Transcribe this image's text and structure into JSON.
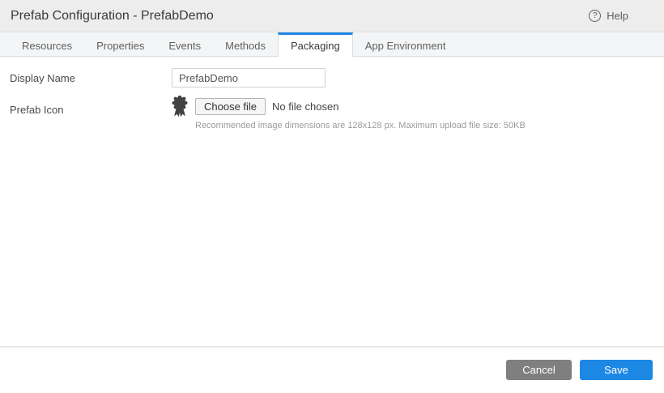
{
  "header": {
    "title": "Prefab Configuration - PrefabDemo",
    "help_label": "Help",
    "help_icon_glyph": "?"
  },
  "tabs": {
    "items": [
      {
        "label": "Resources",
        "active": false
      },
      {
        "label": "Properties",
        "active": false
      },
      {
        "label": "Events",
        "active": false
      },
      {
        "label": "Methods",
        "active": false
      },
      {
        "label": "Packaging",
        "active": true
      },
      {
        "label": "App Environment",
        "active": false
      }
    ]
  },
  "form": {
    "display_name": {
      "label": "Display Name",
      "value": "PrefabDemo"
    },
    "prefab_icon": {
      "label": "Prefab Icon",
      "icon_name": "medal-icon",
      "choose_file_label": "Choose file",
      "file_status": "No file chosen",
      "hint": "Recommended image dimensions are 128x128 px. Maximum upload file size: 50KB"
    }
  },
  "footer": {
    "cancel_label": "Cancel",
    "save_label": "Save"
  },
  "colors": {
    "accent_blue": "#1d87e4",
    "cancel_gray": "#7f7f7f",
    "header_bg": "#ededee",
    "tabbar_bg": "#f4f5f6",
    "medal_icon": "#424242"
  }
}
